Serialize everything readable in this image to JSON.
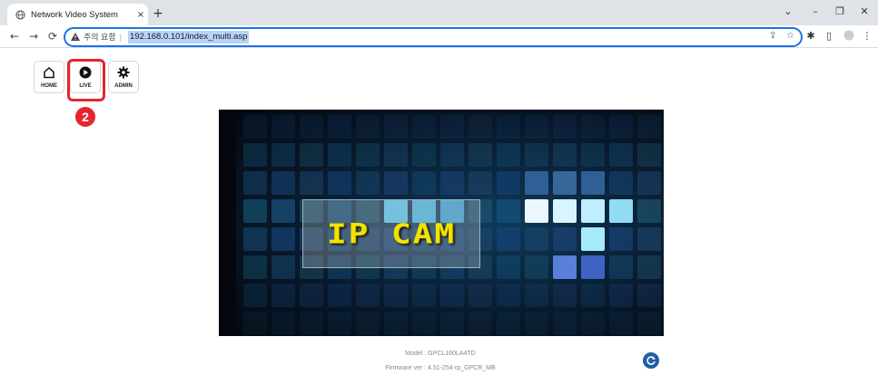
{
  "browser": {
    "tab_title": "Network Video System",
    "tab_close": "×",
    "new_tab": "+",
    "security_label": "주의 요함",
    "url": "192.168.0.101/index_multi.asp",
    "window_controls": {
      "collapse": "⌄",
      "minimize": "–",
      "restore": "❐",
      "close": "✕"
    }
  },
  "nav": {
    "items": [
      {
        "label": "HOME",
        "icon": "home-icon"
      },
      {
        "label": "LIVE",
        "icon": "play-circle-icon"
      },
      {
        "label": "ADMIN",
        "icon": "gear-icon"
      }
    ],
    "highlight_badge": "2"
  },
  "video": {
    "overlay_text": "IP CAM"
  },
  "info": {
    "model": "Model : GPCL160LA4TD",
    "firmware": "Firmware ver : 4.51-254-rp_GPCR_MB"
  },
  "colors": {
    "highlight": "#e3262e",
    "accent": "#1a73e8",
    "logo_text": "#f2e200"
  }
}
